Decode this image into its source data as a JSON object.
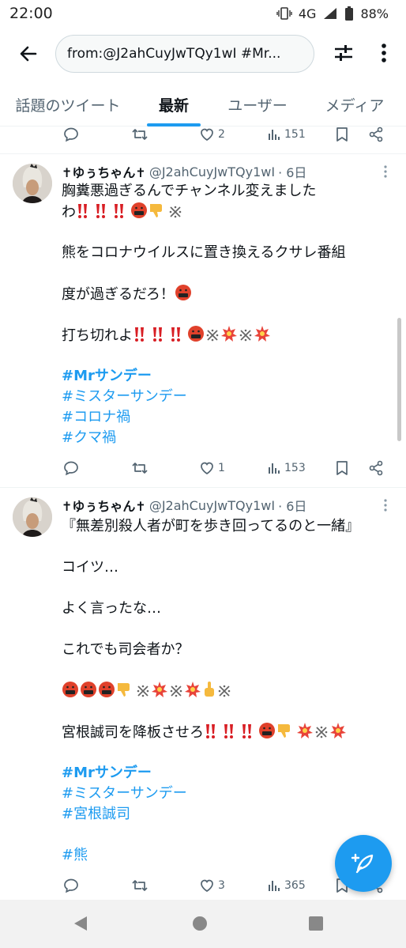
{
  "status_bar": {
    "time": "22:00",
    "network": "4G",
    "battery": "88%"
  },
  "search": {
    "query": "from:@J2ahCuyJwTQy1wI #Mr..."
  },
  "tabs": [
    {
      "label": "話題のツイート",
      "active": false
    },
    {
      "label": "最新",
      "active": true
    },
    {
      "label": "ユーザー",
      "active": false
    },
    {
      "label": "メディア",
      "active": false
    }
  ],
  "prev_tweet_actions": {
    "likes": "2",
    "views": "151"
  },
  "tweets": [
    {
      "name": "✝ゆぅちゃん✝",
      "handle": "@J2ahCuyJwTQy1wI",
      "time": "· 6日",
      "lines": [
        "胸糞悪過ぎるんでチャンネル変えました",
        "わ",
        "熊をコロナウイルスに置き換えるクサレ番組",
        "度が過ぎるだろ！",
        "打ち切れよ"
      ],
      "hashtags": [
        "#Mrサンデー",
        "#ミスターサンデー",
        "#コロナ禍",
        "#クマ禍"
      ],
      "likes": "1",
      "views": "153"
    },
    {
      "name": "✝ゆぅちゃん✝",
      "handle": "@J2ahCuyJwTQy1wI",
      "time": "· 6日",
      "lines": [
        "『無差別殺人者が町を歩き回ってるのと一緒』",
        "コイツ…",
        "よく言ったな…",
        "これでも司会者か？",
        "宮根誠司を降板させろ"
      ],
      "hashtags": [
        "#Mrサンデー",
        "#ミスターサンデー",
        "#宮根誠司",
        "#熊"
      ],
      "likes": "3",
      "views": "365"
    }
  ],
  "icons": {
    "accent": "#1d9bf0",
    "emoji": [
      "double-exclamation-icon",
      "cursing-face-icon",
      "thumbs-down-icon",
      "reference-mark-icon",
      "anger-symbol-icon",
      "middle-finger-icon"
    ]
  }
}
